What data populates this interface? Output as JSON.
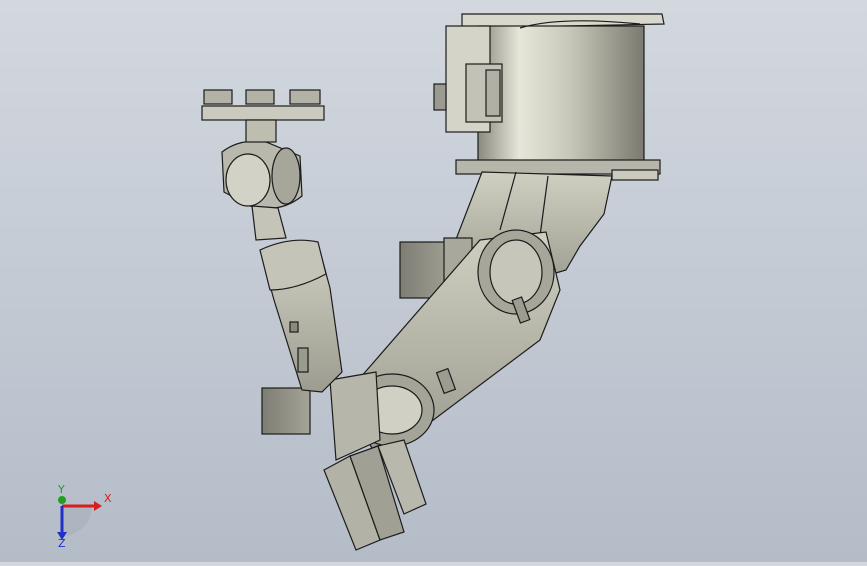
{
  "viewport": {
    "model": "robot-arm-assembly",
    "colors": {
      "background_top": "#d3d8df",
      "background_bottom": "#b4bcc8",
      "metal_light": "#e2e2d6",
      "metal_mid": "#bcbcae",
      "metal_dark": "#8a8a80",
      "edge": "#1c1c1c"
    }
  },
  "triad": {
    "x_label": "X",
    "y_label": "Y",
    "z_label": "Z",
    "colors": {
      "x": "#d42020",
      "y": "#20a020",
      "z": "#2030c8"
    }
  }
}
